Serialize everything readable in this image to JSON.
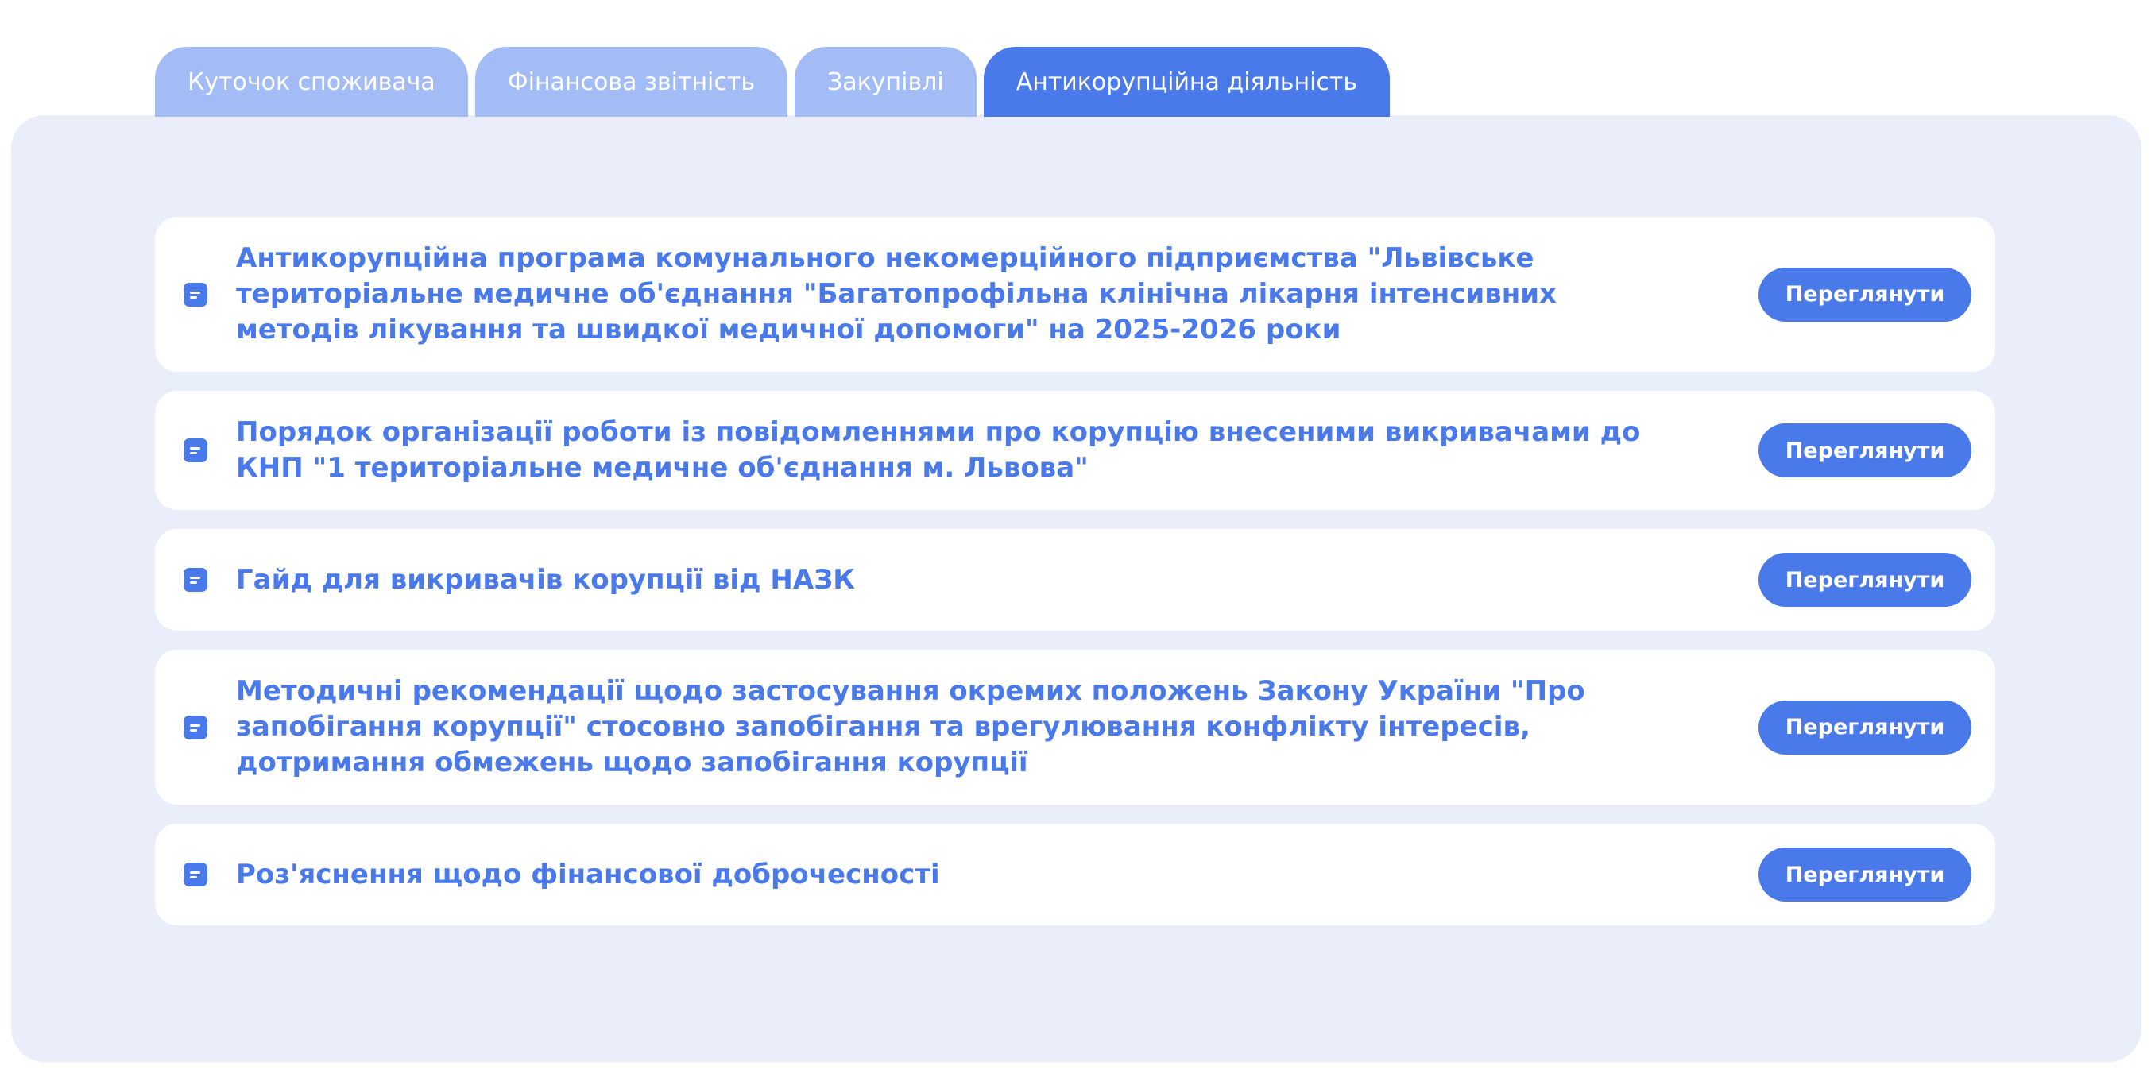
{
  "tabs": [
    {
      "label": "Куточок споживача",
      "active": false
    },
    {
      "label": "Фінансова звітність",
      "active": false
    },
    {
      "label": "Закупівлі",
      "active": false
    },
    {
      "label": "Антикорупційна діяльність",
      "active": true
    }
  ],
  "documents": [
    {
      "icon": "document-icon",
      "title": "Антикорупційна програма комунального некомерційного підприємства \"Львівське територіальне медичне об'єднання \"Багатопрофільна клінічна лікарня інтенсивних методів лікування та швидкої медичної допомоги\" на 2025-2026 роки",
      "button_label": "Переглянути"
    },
    {
      "icon": "document-icon",
      "title": "Порядок організації роботи із повідомленнями про корупцію внесеними викривачами до КНП \"1 територіальне медичне об'єднання м. Львова\"",
      "button_label": "Переглянути"
    },
    {
      "icon": "document-icon",
      "title": "Гайд для викривачів корупції від НАЗК",
      "button_label": "Переглянути"
    },
    {
      "icon": "document-icon",
      "title": "Методичні рекомендації щодо застосування окремих положень Закону України \"Про запобігання корупції\" стосовно запобігання та врегулювання конфлікту інтересів, дотримання обмежень щодо запобігання корупції",
      "button_label": "Переглянути"
    },
    {
      "icon": "document-icon",
      "title": "Роз'яснення щодо фінансової доброчесності",
      "button_label": "Переглянути"
    }
  ],
  "colors": {
    "accent": "#4a79ea",
    "tab_inactive": "#a4bcf5",
    "panel_background": "#eaeefb",
    "card_background": "#ffffff"
  }
}
